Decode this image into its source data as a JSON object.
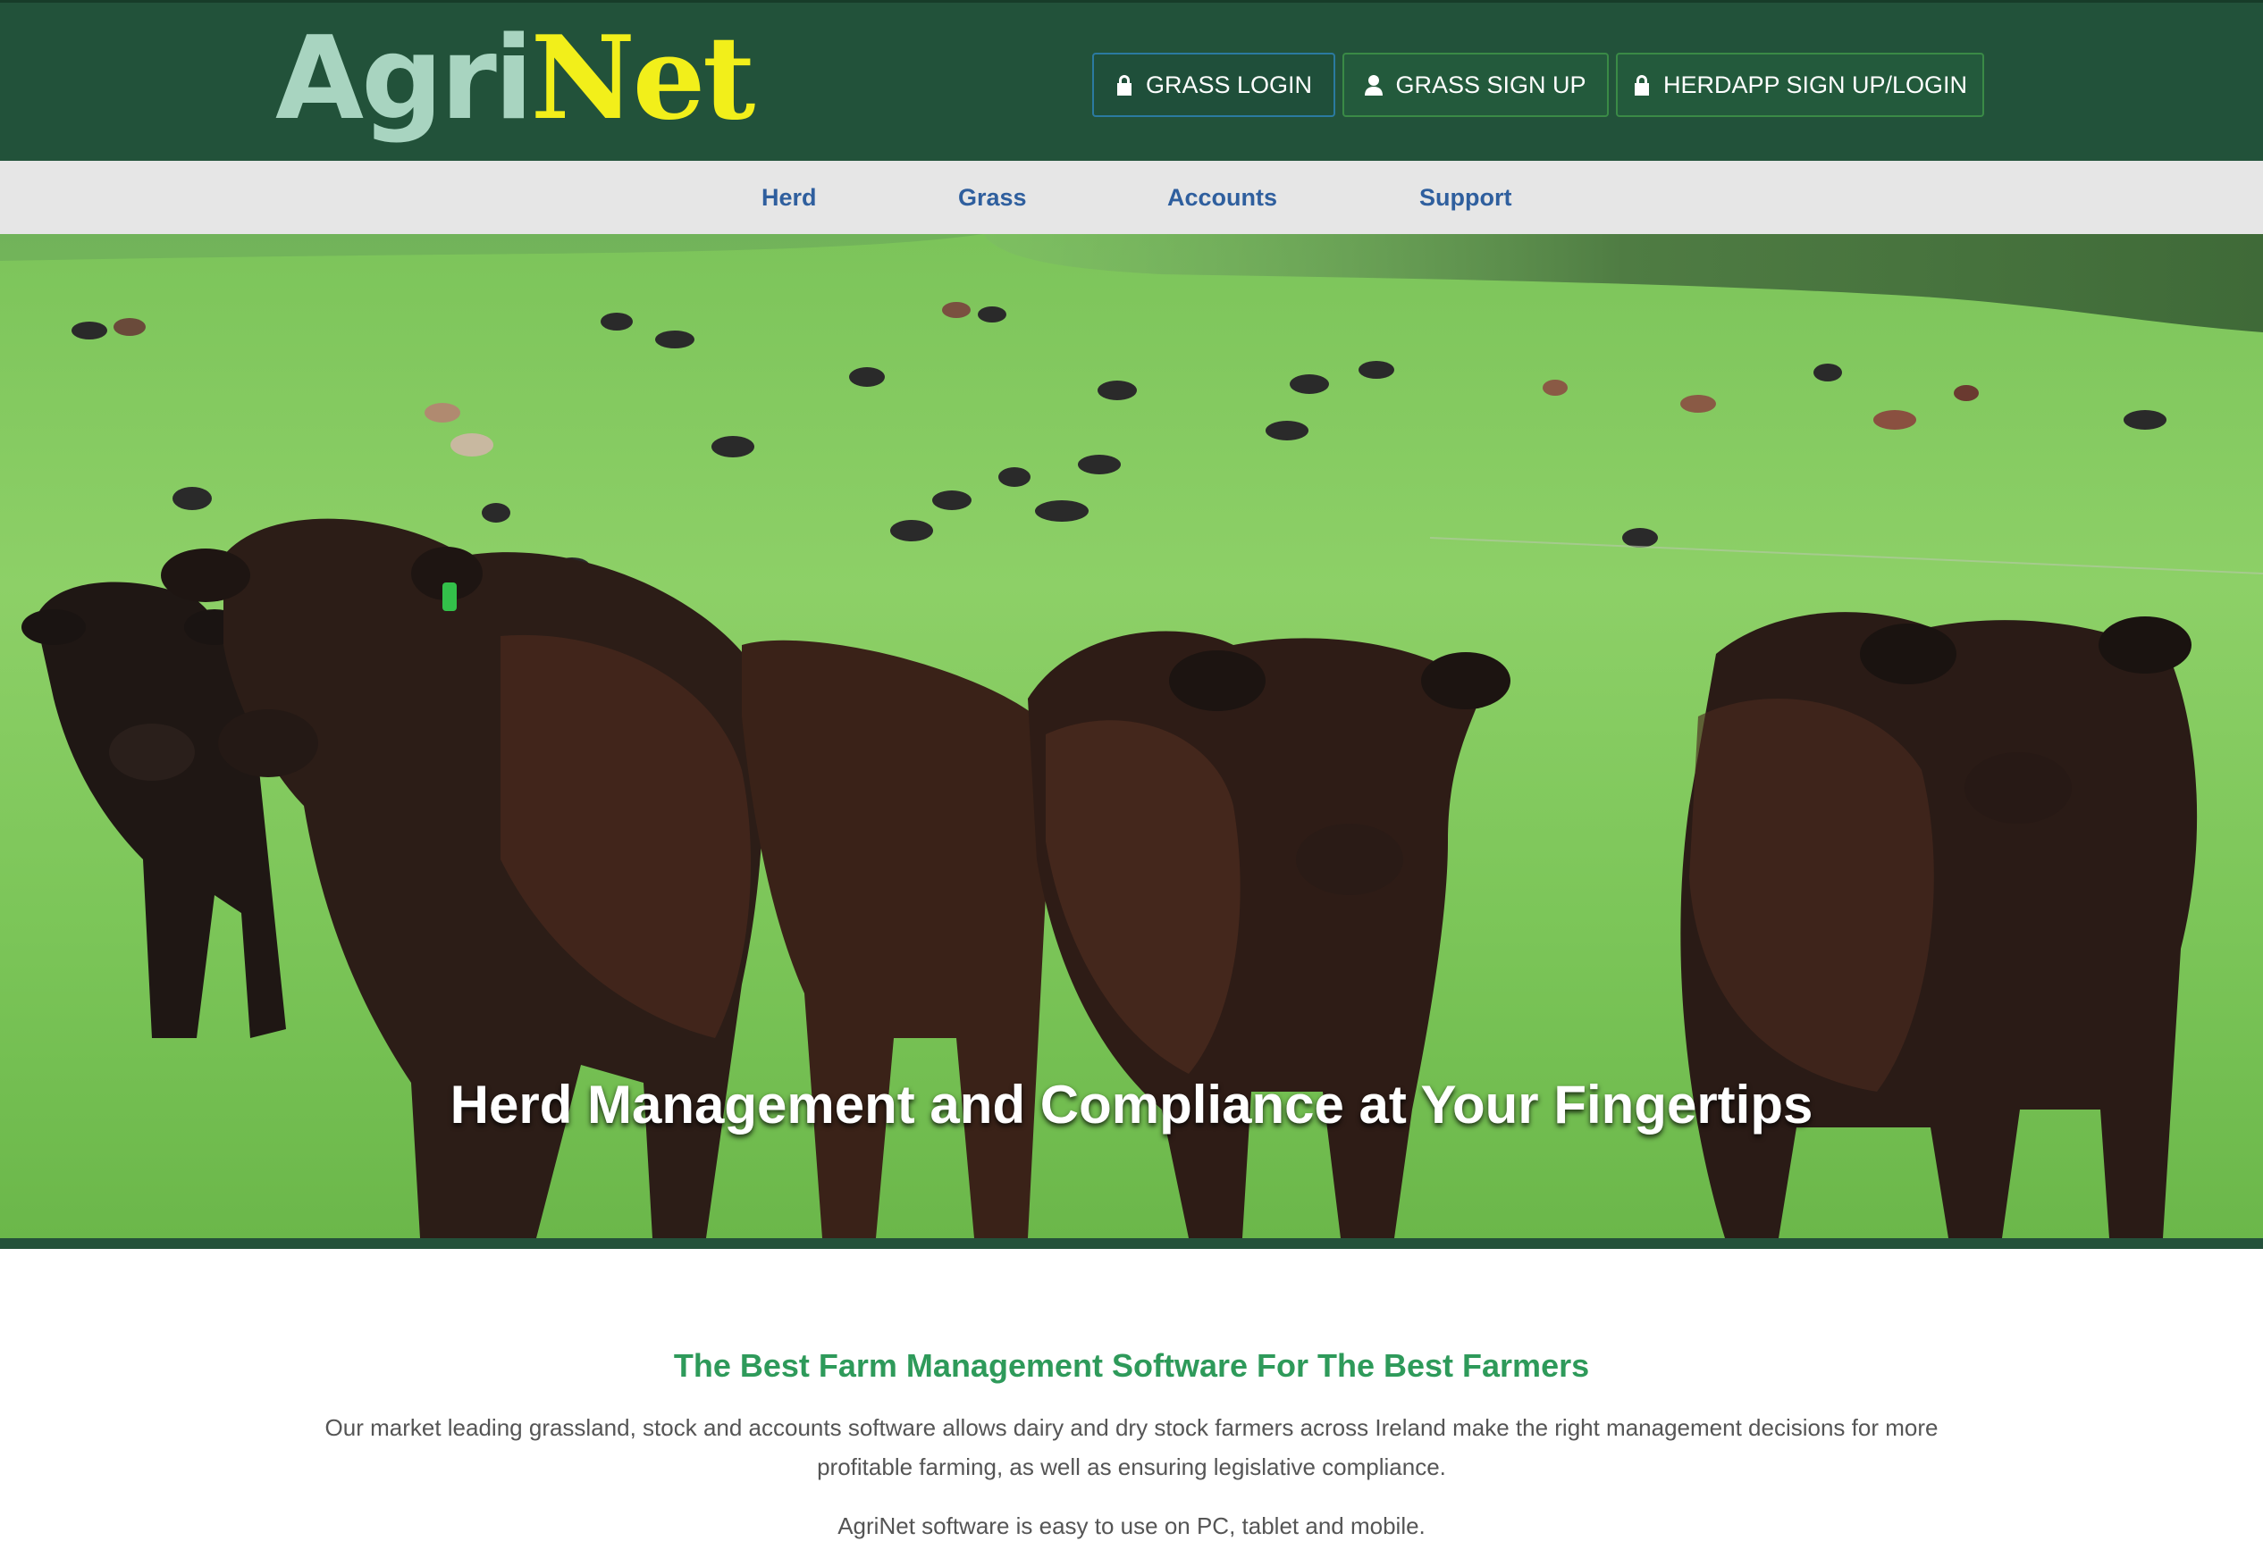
{
  "brand": {
    "logo_part1": "Agri",
    "logo_part2": "Net"
  },
  "header": {
    "buttons": [
      {
        "label": "GRASS LOGIN",
        "icon": "lock-icon"
      },
      {
        "label": "GRASS SIGN UP",
        "icon": "user-icon"
      },
      {
        "label": "HERDAPP SIGN UP/LOGIN",
        "icon": "lock-icon"
      }
    ]
  },
  "nav": {
    "items": [
      "Herd",
      "Grass",
      "Accounts",
      "Support"
    ]
  },
  "hero": {
    "title": "Herd Management and Compliance at Your Fingertips"
  },
  "intro": {
    "heading": "The Best Farm Management Software For The Best Farmers",
    "paragraph": "Our market leading grassland, stock and accounts software allows dairy and dry stock farmers across Ireland make the right management decisions for more profitable farming, as well as ensuring legislative compliance.",
    "paragraph2": "AgriNet software is easy to use on PC, tablet and mobile."
  },
  "colors": {
    "header_bg": "#22523a",
    "logo_agri": "#a8d4c0",
    "logo_net": "#f2ef1a",
    "nav_bg": "#e6e6e6",
    "nav_text": "#2f5f9e",
    "heading_green": "#2e9a5a"
  }
}
